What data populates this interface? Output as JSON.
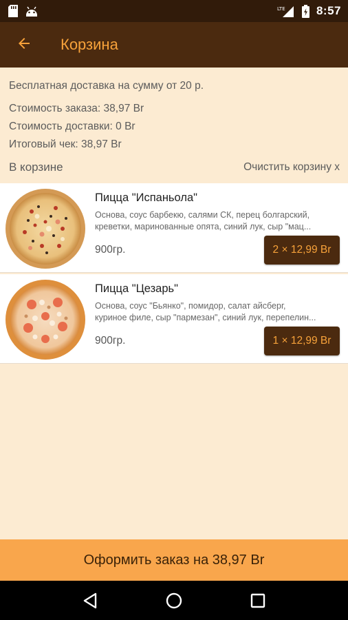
{
  "status_bar": {
    "time": "8:57",
    "network": "LTE",
    "icons": [
      "sd-card-icon",
      "android-icon",
      "signal-icon",
      "battery-icon"
    ]
  },
  "app_bar": {
    "title": "Корзина",
    "back_icon": "arrow-left-icon"
  },
  "info": {
    "free_delivery": "Бесплатная доставка на сумму от 20 р.",
    "order_cost": "Стоимость заказа: 38,97 Br",
    "delivery_cost": "Стоимость доставки: 0 Br",
    "total": "Итоговый чек: 38,97 Br"
  },
  "cart": {
    "header": "В корзине",
    "clear_label": "Очистить корзину x",
    "items": [
      {
        "name": "Пицца \"Испаньола\"",
        "desc_line1": "Основа, соус барбекю, салями СК, перец болгарский,",
        "desc_line2": "креветки, маринованные опята, синий лук, сыр \"мац...",
        "weight": "900гр.",
        "qty_label": "2 × 12,99 Br"
      },
      {
        "name": "Пицца \"Цезарь\"",
        "desc_line1": "Основа, соус \"Бьянко\", помидор, салат айсберг,",
        "desc_line2": "куриное филе, сыр \"пармезан\", синий лук, перепелин...",
        "weight": "900гр.",
        "qty_label": "1 × 12,99 Br"
      }
    ]
  },
  "checkout": {
    "label": "Оформить заказ на 38,97 Br"
  },
  "nav": {
    "icons": [
      "back-triangle-icon",
      "home-circle-icon",
      "recents-square-icon"
    ]
  },
  "colors": {
    "status_bar": "#311b0a",
    "app_bar": "#4b2a0f",
    "accent": "#f7a23a",
    "background": "#fcebd2",
    "checkout": "#f9a64c"
  }
}
